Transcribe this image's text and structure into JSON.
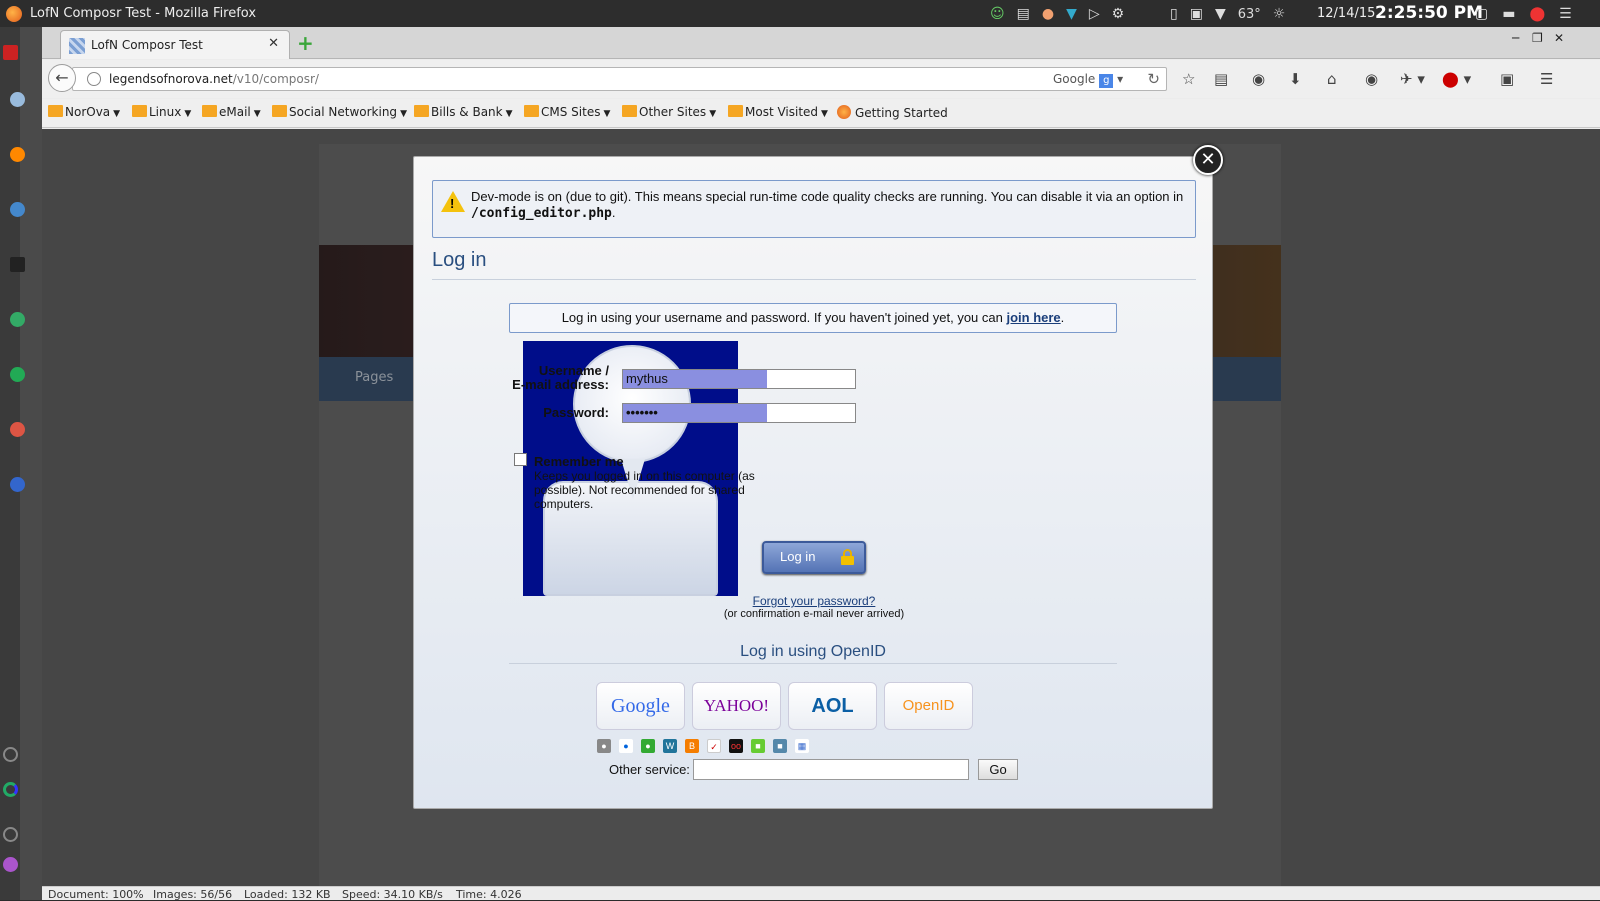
{
  "os_bar": {
    "window_title": "LofN Composr Test - Mozilla Firefox",
    "weather": "63°",
    "date": "12/14/15",
    "time": "2:25:50 PM"
  },
  "browser": {
    "tab_title": "LofN Composr Test",
    "url_host": "legendsofnorova.net",
    "url_path": "/v10/composr/",
    "search_engine": "Google",
    "bookmarks": [
      {
        "label": "NorOva",
        "type": "folder"
      },
      {
        "label": "Linux",
        "type": "folder"
      },
      {
        "label": "eMail",
        "type": "folder"
      },
      {
        "label": "Social Networking",
        "type": "folder"
      },
      {
        "label": "Bills & Bank",
        "type": "folder"
      },
      {
        "label": "CMS Sites",
        "type": "folder"
      },
      {
        "label": "Other Sites",
        "type": "folder"
      },
      {
        "label": "Most Visited",
        "type": "folder"
      },
      {
        "label": "Getting Started",
        "type": "link"
      }
    ],
    "status": {
      "document": "Document: 100%",
      "images": "Images: 56/56",
      "loaded": "Loaded: 132 KB",
      "speed": "Speed: 34.10 KB/s",
      "time": "Time: 4.026"
    }
  },
  "site": {
    "nav_pages": "Pages"
  },
  "modal": {
    "dev_notice": "Dev-mode is on (due to git). This means special run-time code quality checks are running. You can disable it via an option in",
    "dev_notice_path": "/config_editor.php",
    "heading": "Log in",
    "info_text": "Log in using your username and password. If you haven't joined yet, you can",
    "join_link": "join here",
    "username_label_1": "Username /",
    "username_label_2": "E-mail address:",
    "username_value": "mythus",
    "password_label": "Password:",
    "password_value": "•••••••",
    "remember_label": "Remember me",
    "remember_help": "Keeps you logged in on this computer (as possible). Not recommended for shared computers.",
    "login_button": "Log in",
    "forgot_link": "Forgot your password?",
    "forgot_sub": "(or confirmation e-mail never arrived)",
    "openid_heading": "Log in using OpenID",
    "providers": [
      "Google",
      "YAHOO!",
      "AOL",
      "OpenID"
    ],
    "other_service_label": "Other service:",
    "go_button": "Go"
  },
  "colors": {
    "accent": "#2a4f80",
    "avatar_bg": "#000d8a",
    "button": "#5473b5"
  }
}
